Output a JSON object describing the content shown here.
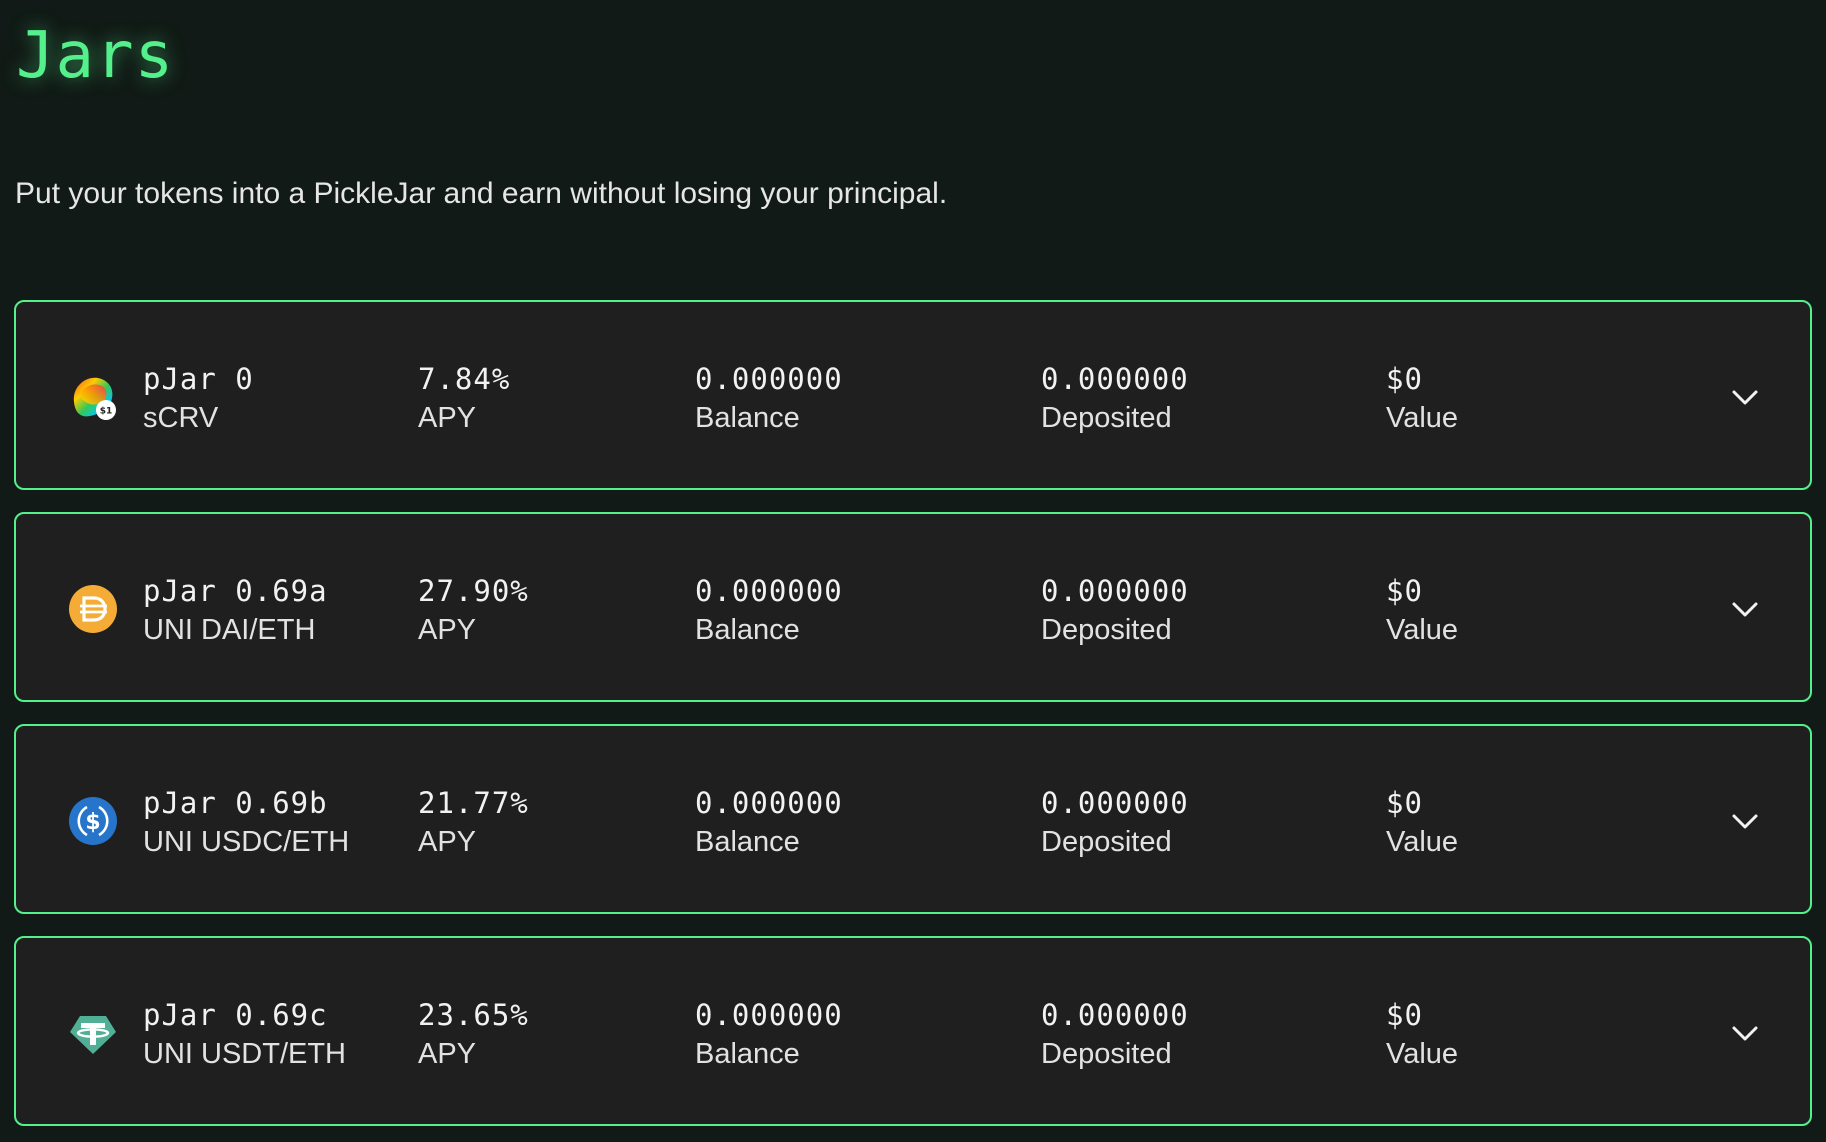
{
  "page": {
    "title": "Jars",
    "subtitle": "Put your tokens into a PickleJar and earn without losing your principal."
  },
  "colors": {
    "accent": "#53f08c",
    "background": "#111a16",
    "card": "#1f1f1f"
  },
  "jars": [
    {
      "name": "pJar 0",
      "pair": "sCRV",
      "icon": "curve-scrv-icon",
      "apy": "7.84%",
      "apy_label": "APY",
      "balance": "0.000000",
      "balance_label": "Balance",
      "deposited": "0.000000",
      "deposited_label": "Deposited",
      "value": "$0",
      "value_label": "Value"
    },
    {
      "name": "pJar 0.69a",
      "pair": "UNI DAI/ETH",
      "icon": "dai-icon",
      "apy": "27.90%",
      "apy_label": "APY",
      "balance": "0.000000",
      "balance_label": "Balance",
      "deposited": "0.000000",
      "deposited_label": "Deposited",
      "value": "$0",
      "value_label": "Value"
    },
    {
      "name": "pJar 0.69b",
      "pair": "UNI USDC/ETH",
      "icon": "usdc-icon",
      "apy": "21.77%",
      "apy_label": "APY",
      "balance": "0.000000",
      "balance_label": "Balance",
      "deposited": "0.000000",
      "deposited_label": "Deposited",
      "value": "$0",
      "value_label": "Value"
    },
    {
      "name": "pJar 0.69c",
      "pair": "UNI USDT/ETH",
      "icon": "usdt-icon",
      "apy": "23.65%",
      "apy_label": "APY",
      "balance": "0.000000",
      "balance_label": "Balance",
      "deposited": "0.000000",
      "deposited_label": "Deposited",
      "value": "$0",
      "value_label": "Value"
    }
  ]
}
